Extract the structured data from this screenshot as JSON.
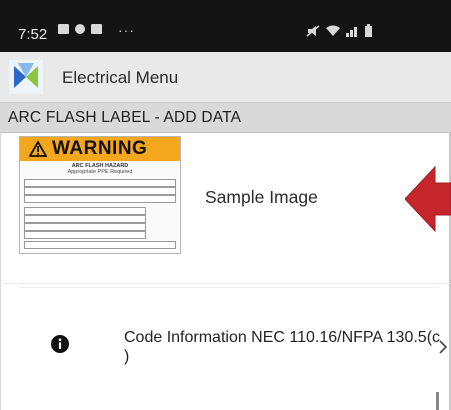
{
  "status_bar": {
    "time": "7:52",
    "more": "···"
  },
  "app_bar": {
    "title": "Electrical Menu"
  },
  "section": {
    "title": "ARC FLASH LABEL - ADD DATA"
  },
  "label_image": {
    "warning": "WARNING",
    "line1": "ARC FLASH HAZARD",
    "line2": "Appropriate PPE Required"
  },
  "sample": {
    "caption": "Sample Image"
  },
  "code_info": {
    "text": "Code Information NEC 110.16/NFPA 130.5(c )"
  },
  "colors": {
    "status_bg": "#141414",
    "app_bar_bg": "#e9e9e9",
    "section_bg": "#d9d9d9",
    "warning_orange": "#f4a71d",
    "arrow_red": "#c4262b",
    "logo_blue": "#2b67c7",
    "logo_green": "#8cc63f"
  },
  "icons": {
    "app_logo": "app-logo",
    "info": "info-circle-icon",
    "chevron": "chevron-right-icon",
    "arrow": "left-arrow-icon",
    "warning": "warning-triangle-icon"
  }
}
